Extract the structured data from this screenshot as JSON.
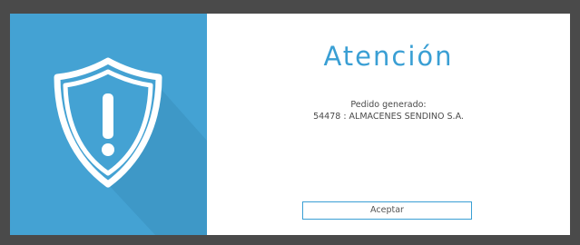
{
  "dialog": {
    "title": "Atención",
    "message_line1": "Pedido generado:",
    "message_line2": "54478 : ALMACENES SENDINO S.A.",
    "accept_label": "Aceptar"
  },
  "icon": {
    "name": "shield-warning-icon",
    "panel_color": "#44a2d3",
    "accent_color": "#3a9fd4"
  }
}
